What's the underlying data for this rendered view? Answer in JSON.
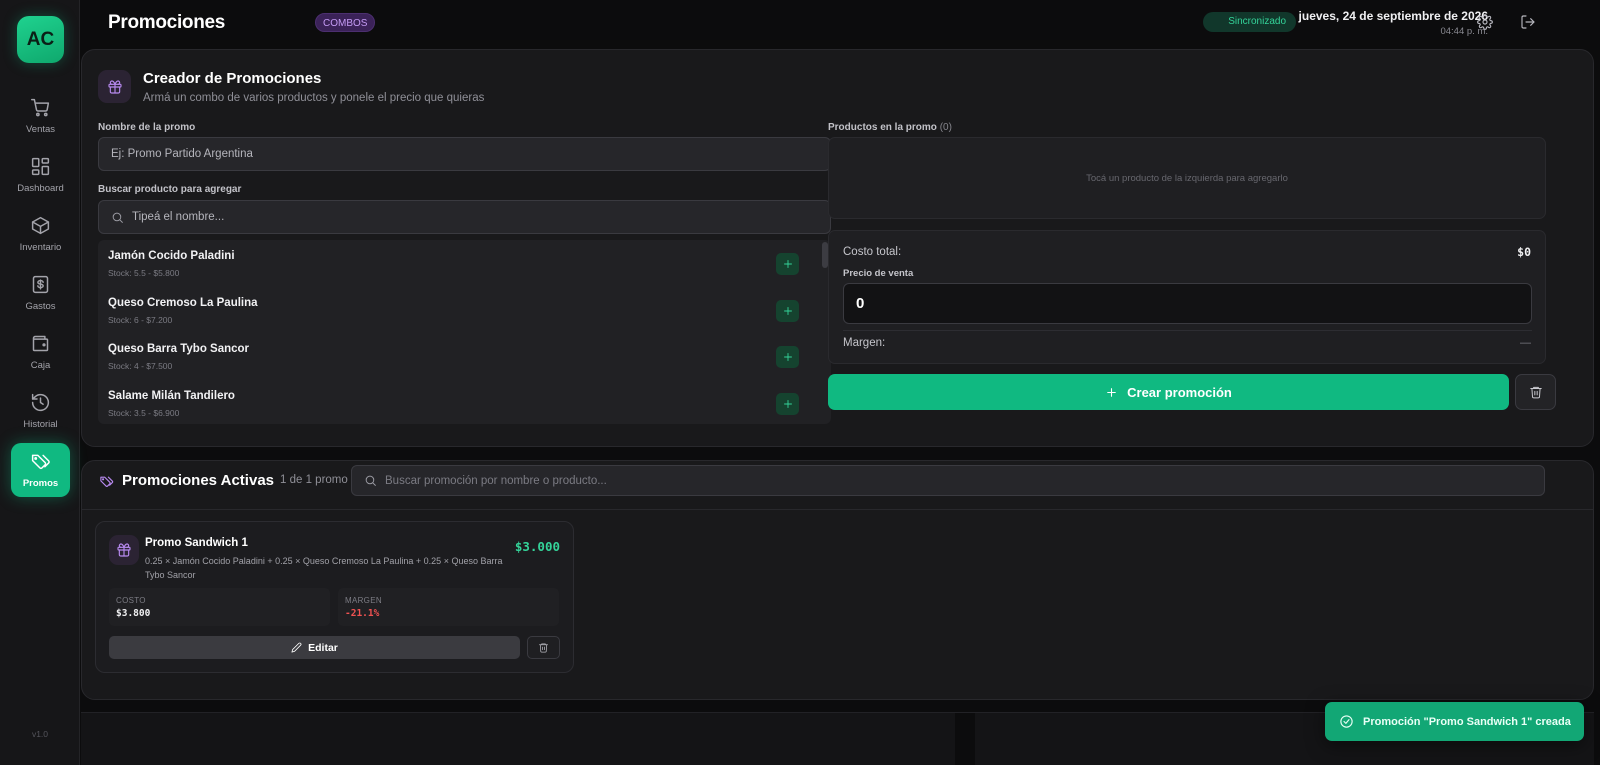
{
  "sidebar": {
    "logo": "AC",
    "items": [
      {
        "label": "Ventas",
        "icon": "cart-icon"
      },
      {
        "label": "Dashboard",
        "icon": "dashboard-icon"
      },
      {
        "label": "Inventario",
        "icon": "box-icon"
      },
      {
        "label": "Gastos",
        "icon": "dollar-icon"
      },
      {
        "label": "Caja",
        "icon": "wallet-icon"
      },
      {
        "label": "Historial",
        "icon": "history-icon"
      },
      {
        "label": "Promos",
        "icon": "tags-icon",
        "active": true
      }
    ],
    "version": "v1.0"
  },
  "header": {
    "title": "Promociones",
    "badge": "COMBOS",
    "sync_status": "Sincronizado",
    "date": "jueves, 24 de septiembre de 2026",
    "time": "04:44 p. m."
  },
  "creator": {
    "title": "Creador de Promociones",
    "subtitle": "Armá un combo de varios productos y ponele el precio que quieras",
    "name_label": "Nombre de la promo",
    "name_placeholder": "Ej: Promo Partido Argentina",
    "search_label": "Buscar producto para agregar",
    "search_placeholder": "Tipeá el nombre...",
    "products": [
      {
        "name": "Jamón Cocido Paladini",
        "stock": "Stock: 5.5 - $5.800"
      },
      {
        "name": "Queso Cremoso La Paulina",
        "stock": "Stock: 6 - $7.200"
      },
      {
        "name": "Queso Barra Tybo Sancor",
        "stock": "Stock: 4 - $7.500"
      },
      {
        "name": "Salame Milán Tandilero",
        "stock": "Stock: 3.5 - $6.900"
      }
    ],
    "promo_products_label": "Productos en la promo",
    "promo_products_count": "(0)",
    "empty_hint": "Tocá un producto de la izquierda para agregarlo",
    "total_cost_label": "Costo total:",
    "total_cost_value": "$0",
    "sale_price_label": "Precio de venta",
    "sale_price_value": "0",
    "margin_label": "Margen:",
    "margin_value": "—",
    "create_button": "Crear promoción"
  },
  "active": {
    "title": "Promociones Activas",
    "count": "1 de 1 promo",
    "search_placeholder": "Buscar promoción por nombre o producto...",
    "promos": [
      {
        "name": "Promo Sandwich 1",
        "description": "0.25 × Jamón Cocido Paladini + 0.25 × Queso Cremoso La Paulina + 0.25 × Queso Barra Tybo Sancor",
        "price": "$3.000",
        "cost_label": "COSTO",
        "cost": "$3.800",
        "margin_label": "MARGEN",
        "margin": "-21.1%",
        "edit_label": "Editar"
      }
    ]
  },
  "toast": {
    "message": "Promoción \"Promo Sandwich 1\" creada"
  },
  "colors": {
    "accent": "#10b981",
    "purple": "#b88af0",
    "negative": "#f05252",
    "background": "#0c0c0d"
  }
}
